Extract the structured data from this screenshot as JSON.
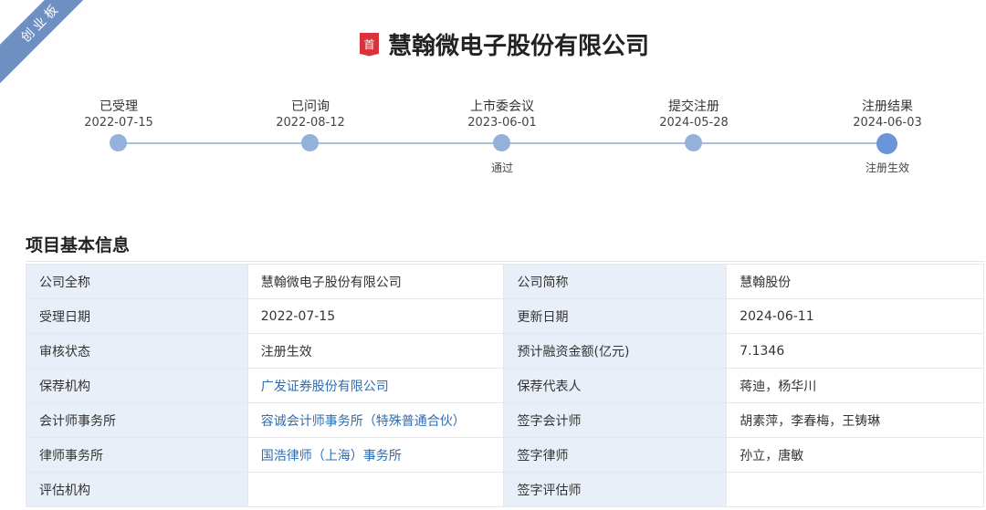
{
  "board": "创业板",
  "badge": "首",
  "company_title": "慧翰微电子股份有限公司",
  "timeline": [
    {
      "label": "已受理",
      "date": "2022-07-15",
      "result": ""
    },
    {
      "label": "已问询",
      "date": "2022-08-12",
      "result": ""
    },
    {
      "label": "上市委会议",
      "date": "2023-06-01",
      "result": "通过"
    },
    {
      "label": "提交注册",
      "date": "2024-05-28",
      "result": ""
    },
    {
      "label": "注册结果",
      "date": "2024-06-03",
      "result": "注册生效"
    }
  ],
  "section_title": "项目基本信息",
  "rows": [
    [
      {
        "k": "公司全称",
        "v": "慧翰微电子股份有限公司"
      },
      {
        "k": "公司简称",
        "v": "慧翰股份"
      }
    ],
    [
      {
        "k": "受理日期",
        "v": "2022-07-15"
      },
      {
        "k": "更新日期",
        "v": "2024-06-11"
      }
    ],
    [
      {
        "k": "审核状态",
        "v": "注册生效"
      },
      {
        "k": "预计融资金额(亿元)",
        "v": "7.1346"
      }
    ],
    [
      {
        "k": "保荐机构",
        "v": "广发证券股份有限公司",
        "link": true
      },
      {
        "k": "保荐代表人",
        "v": "蒋迪，杨华川"
      }
    ],
    [
      {
        "k": "会计师事务所",
        "v": "容诚会计师事务所（特殊普通合伙）",
        "link": true
      },
      {
        "k": "签字会计师",
        "v": "胡素萍，李春梅，王铸琳"
      }
    ],
    [
      {
        "k": "律师事务所",
        "v": "国浩律师（上海）事务所",
        "link": true
      },
      {
        "k": "签字律师",
        "v": "孙立，唐敏"
      }
    ],
    [
      {
        "k": "评估机构",
        "v": ""
      },
      {
        "k": "签字评估师",
        "v": ""
      }
    ]
  ]
}
